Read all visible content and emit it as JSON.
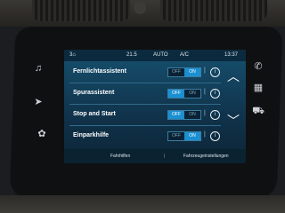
{
  "status": {
    "home_icon": "3⌂",
    "temp": "21.5",
    "mode": "AUTO",
    "ac": "A/C",
    "clock": "13:37"
  },
  "settings": [
    {
      "label": "Fernlichtassistent",
      "off": "OFF",
      "on": "ON",
      "state": "on"
    },
    {
      "label": "Spurassistent",
      "off": "OFF",
      "on": "ON",
      "state": "off"
    },
    {
      "label": "Stop and Start",
      "off": "OFF",
      "on": "ON",
      "state": "off"
    },
    {
      "label": "Einparkhilfe",
      "off": "OFF",
      "on": "ON",
      "state": "on"
    }
  ],
  "info_glyph": "i",
  "tabs": {
    "left": "Fahrhilfen",
    "right": "Fahrzeugeinstellungen"
  },
  "icons": {
    "music": "music-note-icon",
    "navigation": "navigation-icon",
    "apps": "apps-icon",
    "phone": "phone-icon",
    "grid": "grid-icon",
    "car": "car-icon"
  },
  "colors": {
    "accent": "#1a8fd1",
    "screen_bg": "#16506f"
  }
}
